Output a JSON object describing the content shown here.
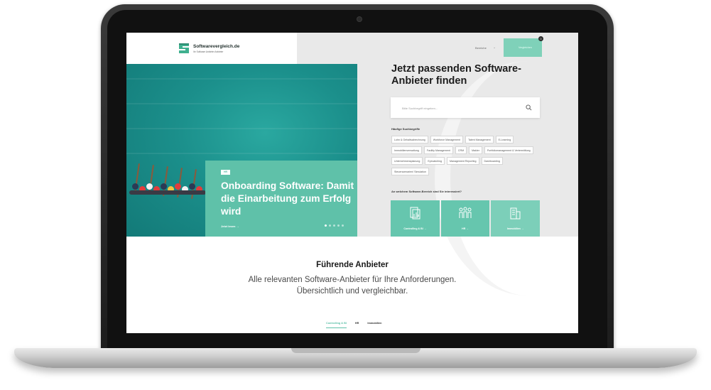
{
  "header": {
    "logo_text": "Softwarevergleich.de",
    "logo_sub": "Ihr Software Anbieter Anbieter",
    "nav_label": "Bereiche",
    "cta_label": "Vergleichen",
    "cta_badge": "0"
  },
  "hero": {
    "card": {
      "tag": "HR",
      "title": "Onboarding Software: Damit die Einarbeitung zum Erfolg wird",
      "link": "Jetzt lesen →",
      "slides_total": 5,
      "slide_active": 1
    },
    "headline": "Jetzt passenden Software-Anbieter finden",
    "search_placeholder": "Bitte Suchbegriff eingeben...",
    "frequent_label": "Häufige Suchbegriffe",
    "chips": [
      "Lohn & Gehaltsabrechnung",
      "Workforce Management",
      "Talent Management",
      "E-Learning",
      "Immobilienverwaltung",
      "Facility Management",
      "CRM",
      "Makler",
      "Portfoliomanagement & Vertermittlung",
      "Unternehmensplanung",
      "Eyecatching",
      "Management Reporting",
      "Dashboarding",
      "Steuerszenarien/ Simulation"
    ],
    "area_label": "An welchem Software-Bereich sind Sie interessiert?",
    "tiles": [
      {
        "label": "Controlling & BI →",
        "icon": "document-chart-icon"
      },
      {
        "label": "HR →",
        "icon": "people-group-icon"
      },
      {
        "label": "Immobilien →",
        "icon": "building-icon"
      }
    ]
  },
  "section": {
    "title": "Führende Anbieter",
    "subtitle_line1": "Alle relevanten Software-Anbieter für Ihre Anforderungen.",
    "subtitle_line2": "Übersichtlich und vergleichbar.",
    "tabs": [
      "Controlling & BI",
      "HR",
      "Immobilien"
    ],
    "active_tab": 0
  },
  "colors": {
    "brand_green": "#5fc1a9",
    "hero_bg": "#e9e9e9",
    "photo_water": "#1b8f8b"
  }
}
